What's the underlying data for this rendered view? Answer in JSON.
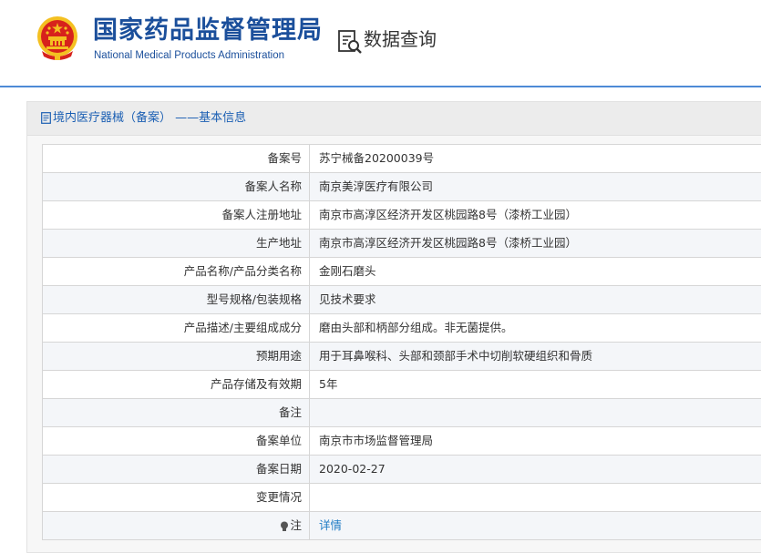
{
  "header": {
    "title_cn": "国家药品监督管理局",
    "title_en": "National Medical Products Administration",
    "query_label": "数据查询",
    "emblem_icon": "national-emblem-icon",
    "query_icon": "document-search-icon"
  },
  "panel": {
    "title": "境内医疗器械（备案） ——基本信息",
    "icon": "document-icon"
  },
  "rows": [
    {
      "label": "备案号",
      "value": "苏宁械备20200039号"
    },
    {
      "label": "备案人名称",
      "value": "南京美淳医疗有限公司"
    },
    {
      "label": "备案人注册地址",
      "value": "南京市高淳区经济开发区桃园路8号（漆桥工业园）"
    },
    {
      "label": "生产地址",
      "value": "南京市高淳区经济开发区桃园路8号（漆桥工业园）"
    },
    {
      "label": "产品名称/产品分类名称",
      "value": "金刚石磨头"
    },
    {
      "label": "型号规格/包装规格",
      "value": "见技术要求"
    },
    {
      "label": "产品描述/主要组成成分",
      "value": "磨由头部和柄部分组成。非无菌提供。"
    },
    {
      "label": "预期用途",
      "value": "用于耳鼻喉科、头部和颈部手术中切削软硬组织和骨质"
    },
    {
      "label": "产品存储及有效期",
      "value": "5年"
    },
    {
      "label": "备注",
      "value": ""
    },
    {
      "label": "备案单位",
      "value": "南京市市场监督管理局"
    },
    {
      "label": "备案日期",
      "value": "2020-02-27"
    },
    {
      "label": "变更情况",
      "value": ""
    },
    {
      "label": "注",
      "value": "详情",
      "icon": "lightbulb-icon"
    }
  ],
  "colors": {
    "brand_blue": "#1b4f9b",
    "link_blue": "#1e7bc4",
    "divider_blue": "#4d8ad6",
    "emblem_red": "#d7221c",
    "emblem_gold": "#f4c021"
  }
}
